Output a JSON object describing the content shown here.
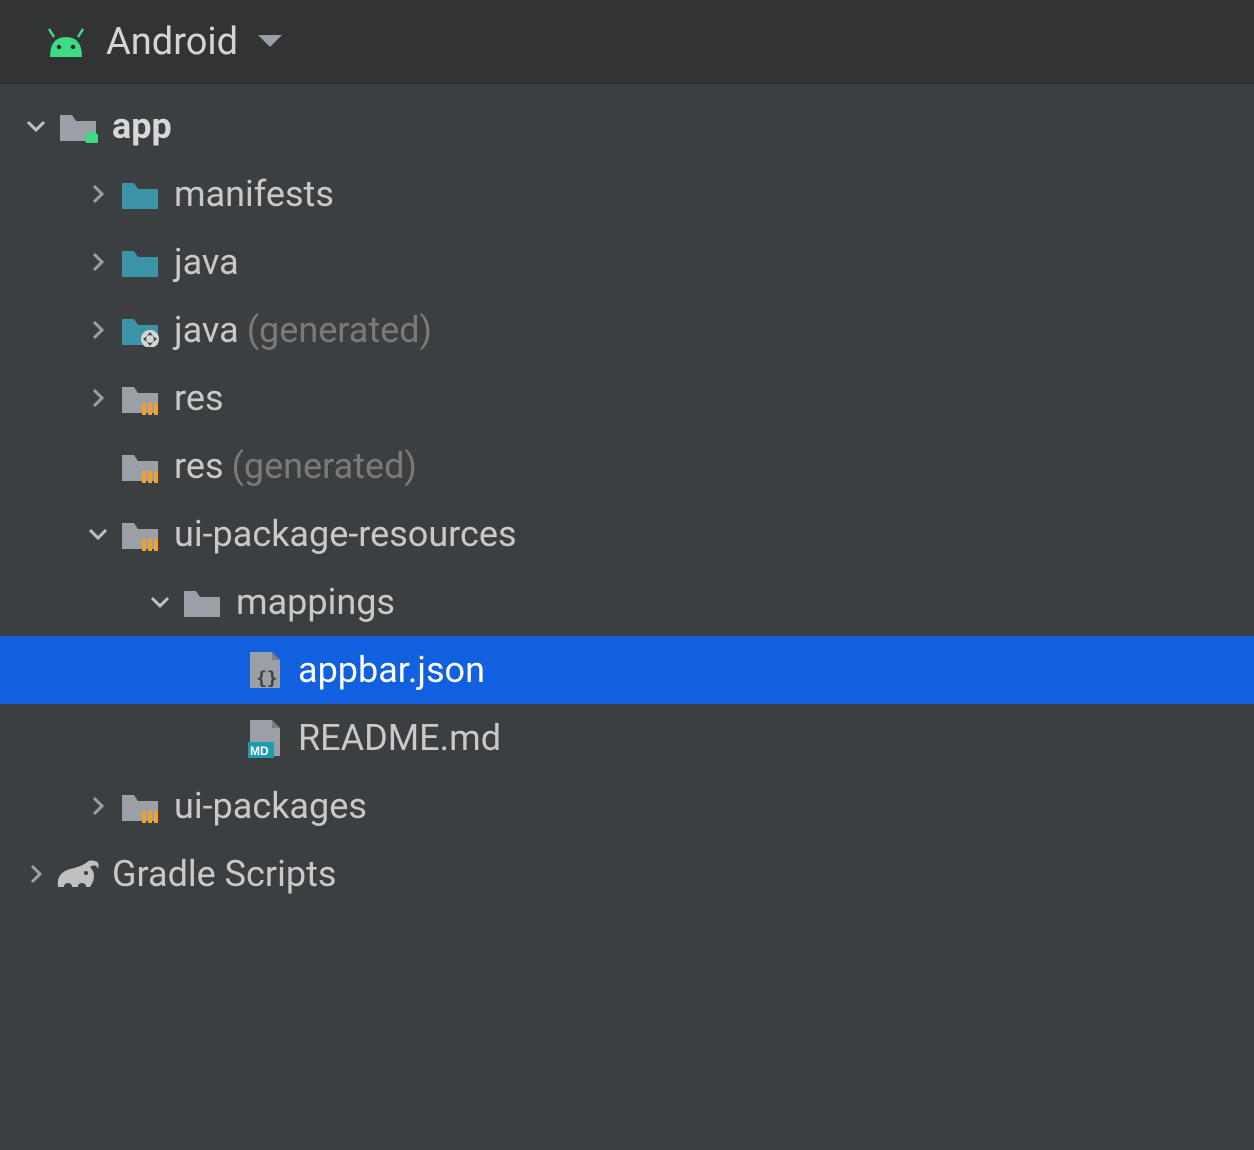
{
  "header": {
    "title": "Android"
  },
  "tree": {
    "app": {
      "label": "app"
    },
    "manifests": {
      "label": "manifests"
    },
    "java": {
      "label": "java"
    },
    "java_gen": {
      "label": "java",
      "suffix": "(generated)"
    },
    "res": {
      "label": "res"
    },
    "res_gen": {
      "label": "res",
      "suffix": "(generated)"
    },
    "ui_pkg_res": {
      "label": "ui-package-resources"
    },
    "mappings": {
      "label": "mappings"
    },
    "appbar": {
      "label": "appbar.json"
    },
    "readme": {
      "label": "README.md"
    },
    "ui_packages": {
      "label": "ui-packages"
    },
    "gradle": {
      "label": "Gradle Scripts"
    }
  },
  "colors": {
    "folder_teal": "#3a93a6",
    "folder_grey": "#9aa0a6",
    "accent_orange": "#f0a030",
    "accent_green": "#3ddc84",
    "md_teal": "#1e9db0",
    "selection": "#1060e0"
  }
}
